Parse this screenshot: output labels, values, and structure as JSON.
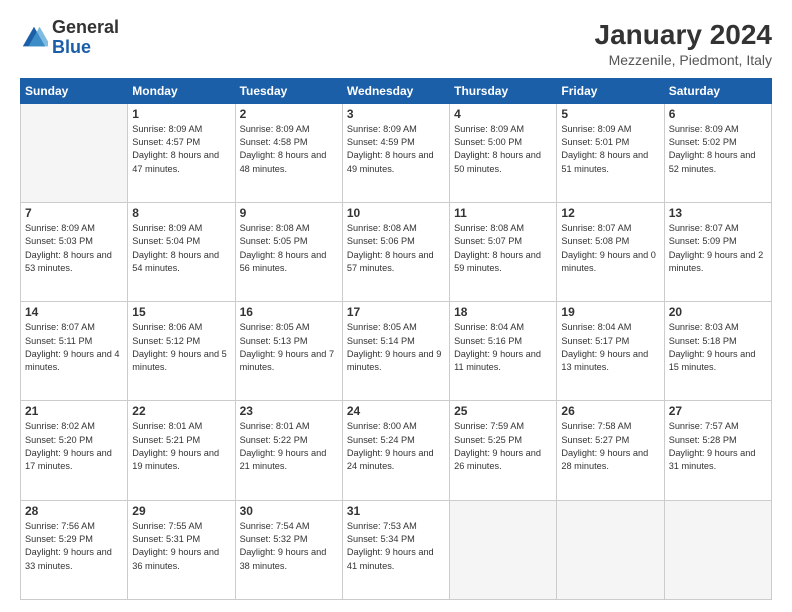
{
  "logo": {
    "general": "General",
    "blue": "Blue"
  },
  "header": {
    "title": "January 2024",
    "subtitle": "Mezzenile, Piedmont, Italy"
  },
  "weekdays": [
    "Sunday",
    "Monday",
    "Tuesday",
    "Wednesday",
    "Thursday",
    "Friday",
    "Saturday"
  ],
  "weeks": [
    [
      {
        "day": null
      },
      {
        "day": "1",
        "sunrise": "8:09 AM",
        "sunset": "4:57 PM",
        "daylight": "8 hours and 47 minutes."
      },
      {
        "day": "2",
        "sunrise": "8:09 AM",
        "sunset": "4:58 PM",
        "daylight": "8 hours and 48 minutes."
      },
      {
        "day": "3",
        "sunrise": "8:09 AM",
        "sunset": "4:59 PM",
        "daylight": "8 hours and 49 minutes."
      },
      {
        "day": "4",
        "sunrise": "8:09 AM",
        "sunset": "5:00 PM",
        "daylight": "8 hours and 50 minutes."
      },
      {
        "day": "5",
        "sunrise": "8:09 AM",
        "sunset": "5:01 PM",
        "daylight": "8 hours and 51 minutes."
      },
      {
        "day": "6",
        "sunrise": "8:09 AM",
        "sunset": "5:02 PM",
        "daylight": "8 hours and 52 minutes."
      }
    ],
    [
      {
        "day": "7",
        "sunrise": "8:09 AM",
        "sunset": "5:03 PM",
        "daylight": "8 hours and 53 minutes."
      },
      {
        "day": "8",
        "sunrise": "8:09 AM",
        "sunset": "5:04 PM",
        "daylight": "8 hours and 54 minutes."
      },
      {
        "day": "9",
        "sunrise": "8:08 AM",
        "sunset": "5:05 PM",
        "daylight": "8 hours and 56 minutes."
      },
      {
        "day": "10",
        "sunrise": "8:08 AM",
        "sunset": "5:06 PM",
        "daylight": "8 hours and 57 minutes."
      },
      {
        "day": "11",
        "sunrise": "8:08 AM",
        "sunset": "5:07 PM",
        "daylight": "8 hours and 59 minutes."
      },
      {
        "day": "12",
        "sunrise": "8:07 AM",
        "sunset": "5:08 PM",
        "daylight": "9 hours and 0 minutes."
      },
      {
        "day": "13",
        "sunrise": "8:07 AM",
        "sunset": "5:09 PM",
        "daylight": "9 hours and 2 minutes."
      }
    ],
    [
      {
        "day": "14",
        "sunrise": "8:07 AM",
        "sunset": "5:11 PM",
        "daylight": "9 hours and 4 minutes."
      },
      {
        "day": "15",
        "sunrise": "8:06 AM",
        "sunset": "5:12 PM",
        "daylight": "9 hours and 5 minutes."
      },
      {
        "day": "16",
        "sunrise": "8:05 AM",
        "sunset": "5:13 PM",
        "daylight": "9 hours and 7 minutes."
      },
      {
        "day": "17",
        "sunrise": "8:05 AM",
        "sunset": "5:14 PM",
        "daylight": "9 hours and 9 minutes."
      },
      {
        "day": "18",
        "sunrise": "8:04 AM",
        "sunset": "5:16 PM",
        "daylight": "9 hours and 11 minutes."
      },
      {
        "day": "19",
        "sunrise": "8:04 AM",
        "sunset": "5:17 PM",
        "daylight": "9 hours and 13 minutes."
      },
      {
        "day": "20",
        "sunrise": "8:03 AM",
        "sunset": "5:18 PM",
        "daylight": "9 hours and 15 minutes."
      }
    ],
    [
      {
        "day": "21",
        "sunrise": "8:02 AM",
        "sunset": "5:20 PM",
        "daylight": "9 hours and 17 minutes."
      },
      {
        "day": "22",
        "sunrise": "8:01 AM",
        "sunset": "5:21 PM",
        "daylight": "9 hours and 19 minutes."
      },
      {
        "day": "23",
        "sunrise": "8:01 AM",
        "sunset": "5:22 PM",
        "daylight": "9 hours and 21 minutes."
      },
      {
        "day": "24",
        "sunrise": "8:00 AM",
        "sunset": "5:24 PM",
        "daylight": "9 hours and 24 minutes."
      },
      {
        "day": "25",
        "sunrise": "7:59 AM",
        "sunset": "5:25 PM",
        "daylight": "9 hours and 26 minutes."
      },
      {
        "day": "26",
        "sunrise": "7:58 AM",
        "sunset": "5:27 PM",
        "daylight": "9 hours and 28 minutes."
      },
      {
        "day": "27",
        "sunrise": "7:57 AM",
        "sunset": "5:28 PM",
        "daylight": "9 hours and 31 minutes."
      }
    ],
    [
      {
        "day": "28",
        "sunrise": "7:56 AM",
        "sunset": "5:29 PM",
        "daylight": "9 hours and 33 minutes."
      },
      {
        "day": "29",
        "sunrise": "7:55 AM",
        "sunset": "5:31 PM",
        "daylight": "9 hours and 36 minutes."
      },
      {
        "day": "30",
        "sunrise": "7:54 AM",
        "sunset": "5:32 PM",
        "daylight": "9 hours and 38 minutes."
      },
      {
        "day": "31",
        "sunrise": "7:53 AM",
        "sunset": "5:34 PM",
        "daylight": "9 hours and 41 minutes."
      },
      {
        "day": null
      },
      {
        "day": null
      },
      {
        "day": null
      }
    ]
  ]
}
